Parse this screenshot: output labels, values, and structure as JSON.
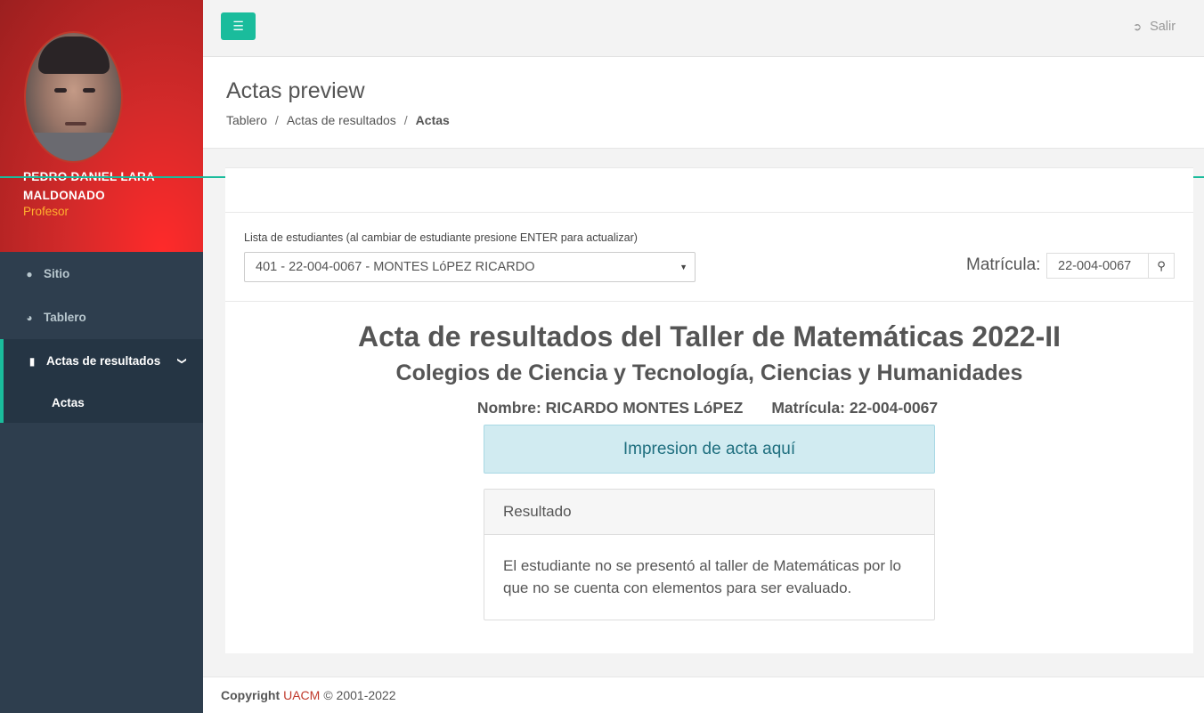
{
  "user": {
    "name": "PEDRO DANIEL LARA MALDONADO",
    "role": "Profesor"
  },
  "sidebar": {
    "items": [
      {
        "icon": "globe-icon",
        "label": "Sitio"
      },
      {
        "icon": "dashboard-icon",
        "label": "Tablero"
      },
      {
        "icon": "document-icon",
        "label": "Actas de resultados",
        "active": true
      }
    ],
    "subitems": [
      {
        "label": "Actas"
      }
    ]
  },
  "topbar": {
    "menu_icon": "hamburger-icon",
    "logout_label": "Salir"
  },
  "page": {
    "title": "Actas preview",
    "breadcrumb": [
      "Tablero",
      "Actas de resultados",
      "Actas"
    ]
  },
  "selector": {
    "label": "Lista de estudiantes (al cambiar de estudiante presione ENTER para actualizar)",
    "selected": "401 - 22-004-0067 - MONTES LóPEZ RICARDO",
    "matricula_label": "Matrícula:",
    "matricula_value": "22-004-0067"
  },
  "acta": {
    "title": "Acta de resultados del Taller de Matemáticas 2022-II",
    "subtitle": "Colegios de Ciencia y Tecnología, Ciencias y Humanidades",
    "nombre": "Nombre: RICARDO MONTES LóPEZ",
    "matricula": "Matrícula: 22-004-0067",
    "print_label": "Impresion de acta aquí",
    "result_header": "Resultado",
    "result_text": "El estudiante no se presentó al taller de Matemáticas por lo que no se cuenta con elementos para ser evaluado."
  },
  "footer": {
    "copyright": "Copyright",
    "brand": "UACM",
    "years": "© 2001-2022"
  },
  "colors": {
    "accent": "#1abc9c",
    "sidebar": "#2e3e4e",
    "profile_red": "#d42a2a",
    "role": "#ffb02e",
    "brand": "#c0392b"
  }
}
